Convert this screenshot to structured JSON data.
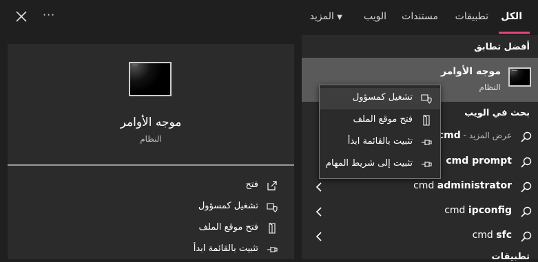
{
  "tabs": [
    {
      "label": "الكل",
      "active": true
    },
    {
      "label": "تطبيقات"
    },
    {
      "label": "مستندات"
    },
    {
      "label": "الويب"
    },
    {
      "label": "المزيد"
    }
  ],
  "colors": {
    "accent": "#e0457b",
    "highlight": "#5a5a5a"
  },
  "best_match": {
    "section_title": "أفضل تطابق",
    "name": "موجه الأوامر",
    "subtitle": "النظام"
  },
  "web_search": {
    "section_title": "بحث في الويب",
    "results": [
      {
        "bold": "cmd",
        "rest": " - عرض المزيد",
        "icon": "search-icon"
      },
      {
        "bold": "cmd prompt",
        "prefix": ""
      },
      {
        "prefix": "cmd ",
        "bold": "administrator"
      },
      {
        "prefix": "cmd ",
        "bold": "ipconfig"
      },
      {
        "prefix": "cmd ",
        "bold": "sfc"
      }
    ],
    "partial_section": "تطبيقات"
  },
  "context_menu": {
    "items": [
      {
        "label": "تشغيل كمسؤول",
        "icon": "shield-icon"
      },
      {
        "label": "فتح موقع الملف",
        "icon": "folder-icon"
      },
      {
        "label": "تثبيت بالقائمة ابدأ",
        "icon": "pin-icon"
      },
      {
        "label": "تثبيت إلى شريط المهام",
        "icon": "pin-icon"
      }
    ]
  },
  "preview": {
    "name": "موجه الأوامر",
    "subtitle": "النظام",
    "actions": [
      {
        "label": "فتح",
        "icon": "open-icon"
      },
      {
        "label": "تشغيل كمسؤول",
        "icon": "shield-icon"
      },
      {
        "label": "فتح موقع الملف",
        "icon": "folder-icon"
      },
      {
        "label": "تثبيت بالقائمة ابدأ",
        "icon": "pin-icon"
      }
    ]
  }
}
